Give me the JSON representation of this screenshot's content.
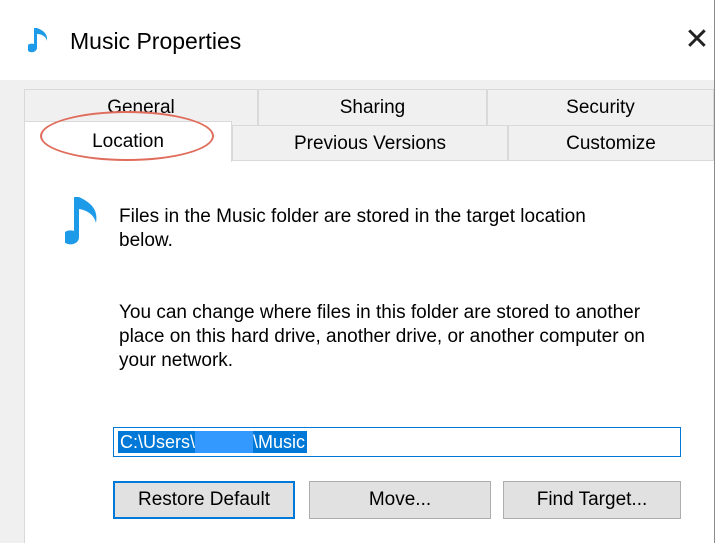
{
  "window": {
    "title": "Music Properties",
    "close_glyph": "✕"
  },
  "tabs": {
    "row1": [
      {
        "label": "General"
      },
      {
        "label": "Sharing"
      },
      {
        "label": "Security"
      }
    ],
    "row2": [
      {
        "label": "Location",
        "active": true
      },
      {
        "label": "Previous Versions"
      },
      {
        "label": "Customize"
      }
    ]
  },
  "location_panel": {
    "icon": "music-note-icon",
    "info_text": "Files in the Music folder are stored in the target location below.",
    "description": "You can change where files in this folder are stored to another place on this hard drive, another drive, or another computer on your network.",
    "path_prefix": "C:\\Users\\",
    "path_suffix": "\\Music",
    "path_redacted": true
  },
  "buttons": {
    "restore_default": "Restore Default",
    "move": "Move...",
    "find_target": "Find Target..."
  },
  "colors": {
    "accent": "#0078d7",
    "icon_blue": "#1e9be8",
    "annotation_red": "#e06c5c"
  }
}
